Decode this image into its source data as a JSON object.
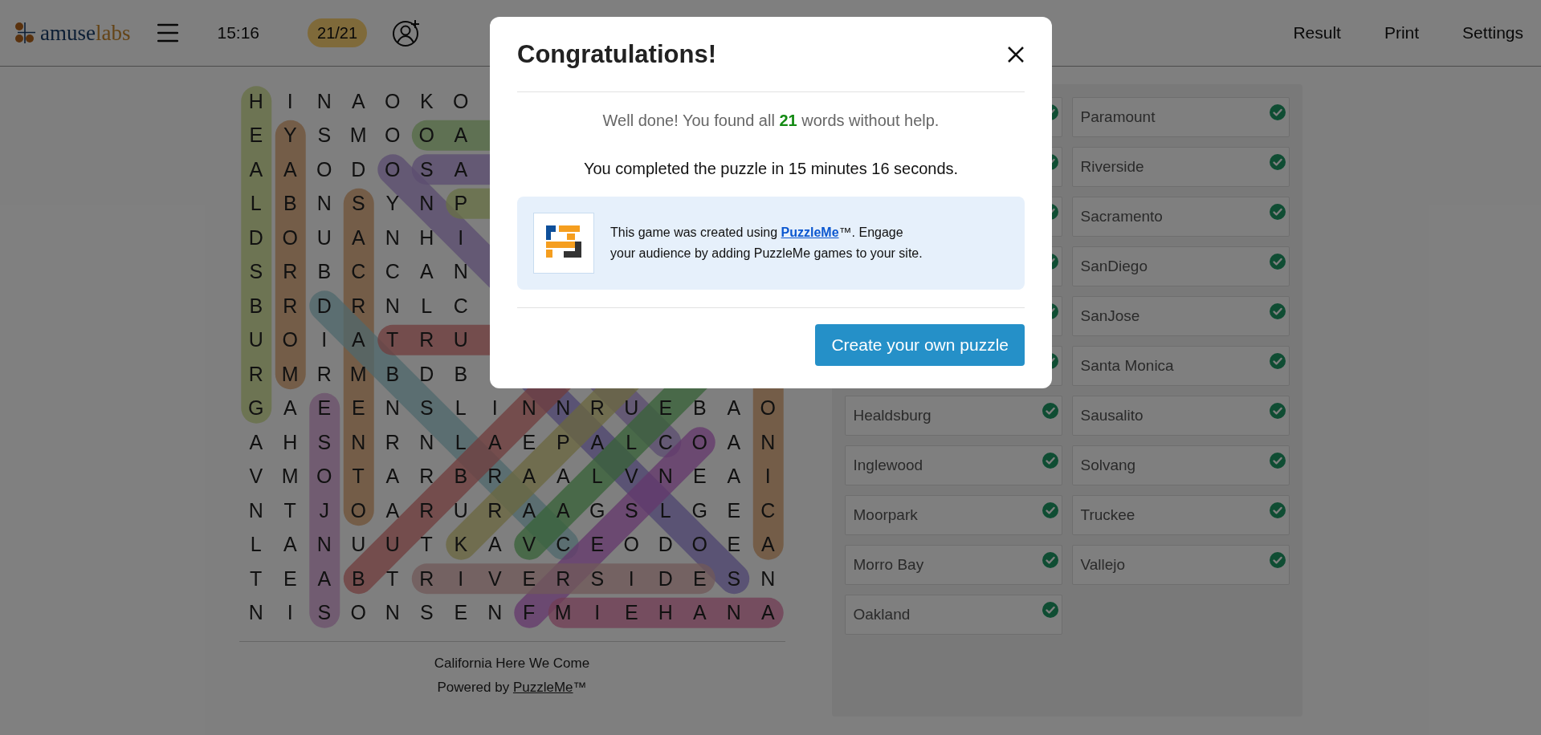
{
  "header": {
    "logo": {
      "first": "amuse",
      "second": "labs"
    },
    "timer": "15:16",
    "progress": "21/21",
    "nav": [
      "Result",
      "Print",
      "Settings"
    ]
  },
  "grid": {
    "rows": [
      [
        "H",
        "I",
        "N",
        "A",
        "O",
        "K",
        "O"
      ],
      [
        "E",
        "Y",
        "S",
        "M",
        "O",
        "O",
        "A"
      ],
      [
        "A",
        "A",
        "O",
        "D",
        "O",
        "S",
        "A"
      ],
      [
        "L",
        "B",
        "N",
        "S",
        "Y",
        "N",
        "P"
      ],
      [
        "D",
        "O",
        "U",
        "A",
        "N",
        "H",
        "I"
      ],
      [
        "S",
        "R",
        "B",
        "C",
        "C",
        "A",
        "N"
      ],
      [
        "B",
        "R",
        "D",
        "R",
        "N",
        "L",
        "C"
      ],
      [
        "U",
        "O",
        "I",
        "A",
        "T",
        "R",
        "U"
      ],
      [
        "R",
        "M",
        "R",
        "M",
        "B",
        "D",
        "B"
      ],
      [
        "G",
        "A",
        "E",
        "E",
        "N",
        "S",
        "L",
        "I",
        "N",
        "N",
        "R",
        "U",
        "E",
        "B",
        "A",
        "O"
      ],
      [
        "A",
        "H",
        "S",
        "N",
        "R",
        "N",
        "L",
        "A",
        "E",
        "P",
        "A",
        "L",
        "C",
        "O",
        "A",
        "N"
      ],
      [
        "V",
        "M",
        "O",
        "T",
        "A",
        "R",
        "B",
        "R",
        "A",
        "A",
        "L",
        "V",
        "N",
        "E",
        "A",
        "I"
      ],
      [
        "N",
        "T",
        "J",
        "O",
        "A",
        "R",
        "U",
        "R",
        "A",
        "A",
        "G",
        "S",
        "L",
        "G",
        "E",
        "C"
      ],
      [
        "L",
        "A",
        "N",
        "U",
        "U",
        "T",
        "K",
        "A",
        "V",
        "C",
        "E",
        "O",
        "D",
        "O",
        "E",
        "A"
      ],
      [
        "T",
        "E",
        "A",
        "B",
        "T",
        "R",
        "I",
        "V",
        "E",
        "R",
        "S",
        "I",
        "D",
        "E",
        "S",
        "N"
      ],
      [
        "N",
        "I",
        "S",
        "O",
        "N",
        "S",
        "E",
        "N",
        "F",
        "M",
        "I",
        "E",
        "H",
        "A",
        "N",
        "A"
      ]
    ]
  },
  "footer": {
    "title": "California Here We Come",
    "powered": "Powered by ",
    "link": "PuzzleMe",
    "mark": "™"
  },
  "words": {
    "left": [
      {
        "found": true
      },
      {
        "found": true
      },
      {
        "found": true
      },
      {
        "found": true
      },
      {
        "found": true
      },
      {
        "found": true
      },
      {
        "word": "Healdsburg",
        "found": true
      },
      {
        "word": "Inglewood",
        "found": true
      },
      {
        "word": "Moorpark",
        "found": true
      },
      {
        "word": "Morro Bay",
        "found": true
      },
      {
        "word": "Oakland",
        "found": true
      }
    ],
    "right": [
      {
        "word": "Paramount",
        "found": true
      },
      {
        "word": "Riverside",
        "found": true
      },
      {
        "word": "Sacramento",
        "found": true
      },
      {
        "word": "SanDiego",
        "found": true
      },
      {
        "word": "SanJose",
        "found": true
      },
      {
        "word": "Santa Monica",
        "found": true
      },
      {
        "word": "Sausalito",
        "found": true
      },
      {
        "word": "Solvang",
        "found": true
      },
      {
        "word": "Truckee",
        "found": true
      },
      {
        "word": "Vallejo",
        "found": true
      }
    ]
  },
  "modal": {
    "title": "Congratulations!",
    "message": "Well done! You found all **21** words without help.",
    "time": "You completed the puzzle in 15 minutes 16 seconds.",
    "info": {
      "before": "This game was created using ",
      "link": "PuzzleMe",
      "after": "™. Engage your audience by adding PuzzleMe games to your site."
    },
    "button": "Create your own puzzle"
  }
}
